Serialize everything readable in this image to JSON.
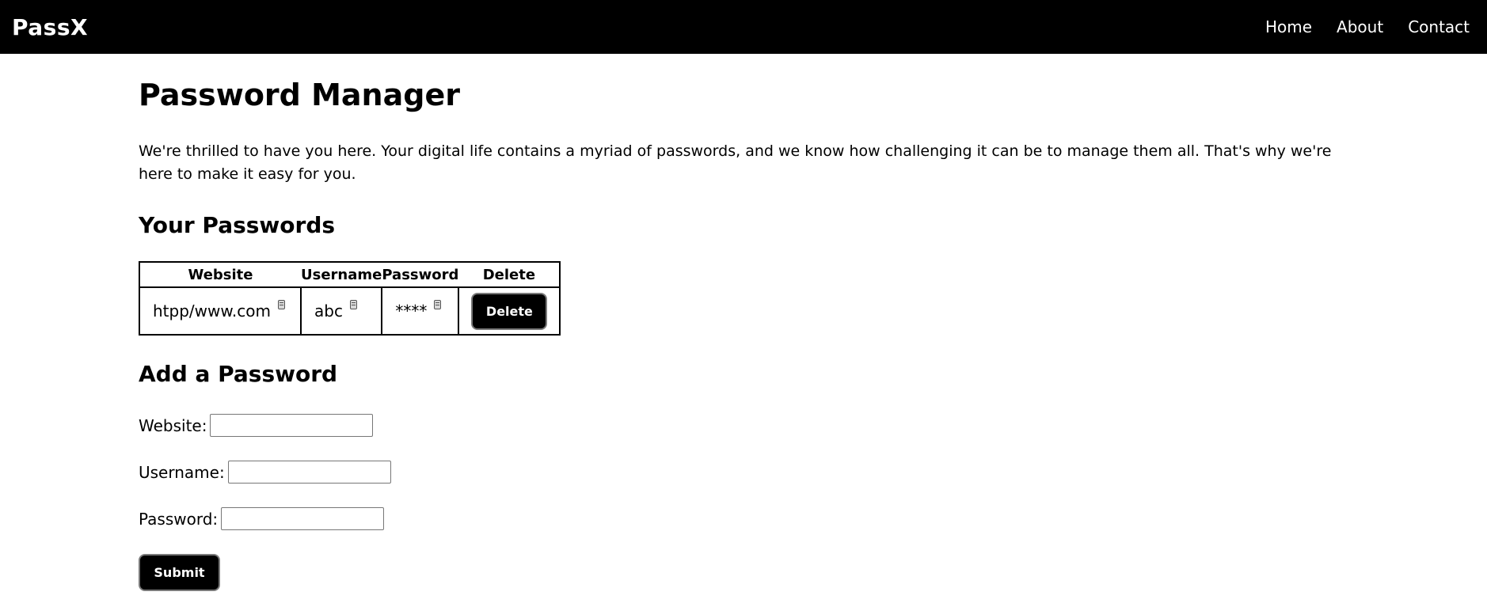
{
  "nav": {
    "logo": "PassX",
    "links": [
      "Home",
      "About",
      "Contact"
    ]
  },
  "main": {
    "title": "Password Manager",
    "intro": "We're thrilled to have you here. Your digital life contains a myriad of passwords, and we know how challenging it can be to manage them all. That's why we're here to make it easy for you."
  },
  "passwords": {
    "heading": "Your Passwords",
    "columns": [
      "Website",
      "Username",
      "Password",
      "Delete"
    ],
    "rows": [
      {
        "website": "htpp/www.com",
        "username": "abc",
        "password": "****",
        "delete_label": "Delete"
      }
    ]
  },
  "add_form": {
    "heading": "Add a Password",
    "website_label": "Website:",
    "website_value": "",
    "username_label": "Username:",
    "username_value": "",
    "password_label": "Password:",
    "password_value": "",
    "submit_label": "Submit"
  },
  "icons": {
    "copy": "copy-icon"
  },
  "colors": {
    "navbar_bg": "#000000",
    "button_bg": "#000000",
    "button_border": "#7a7a7a",
    "text": "#000000"
  }
}
